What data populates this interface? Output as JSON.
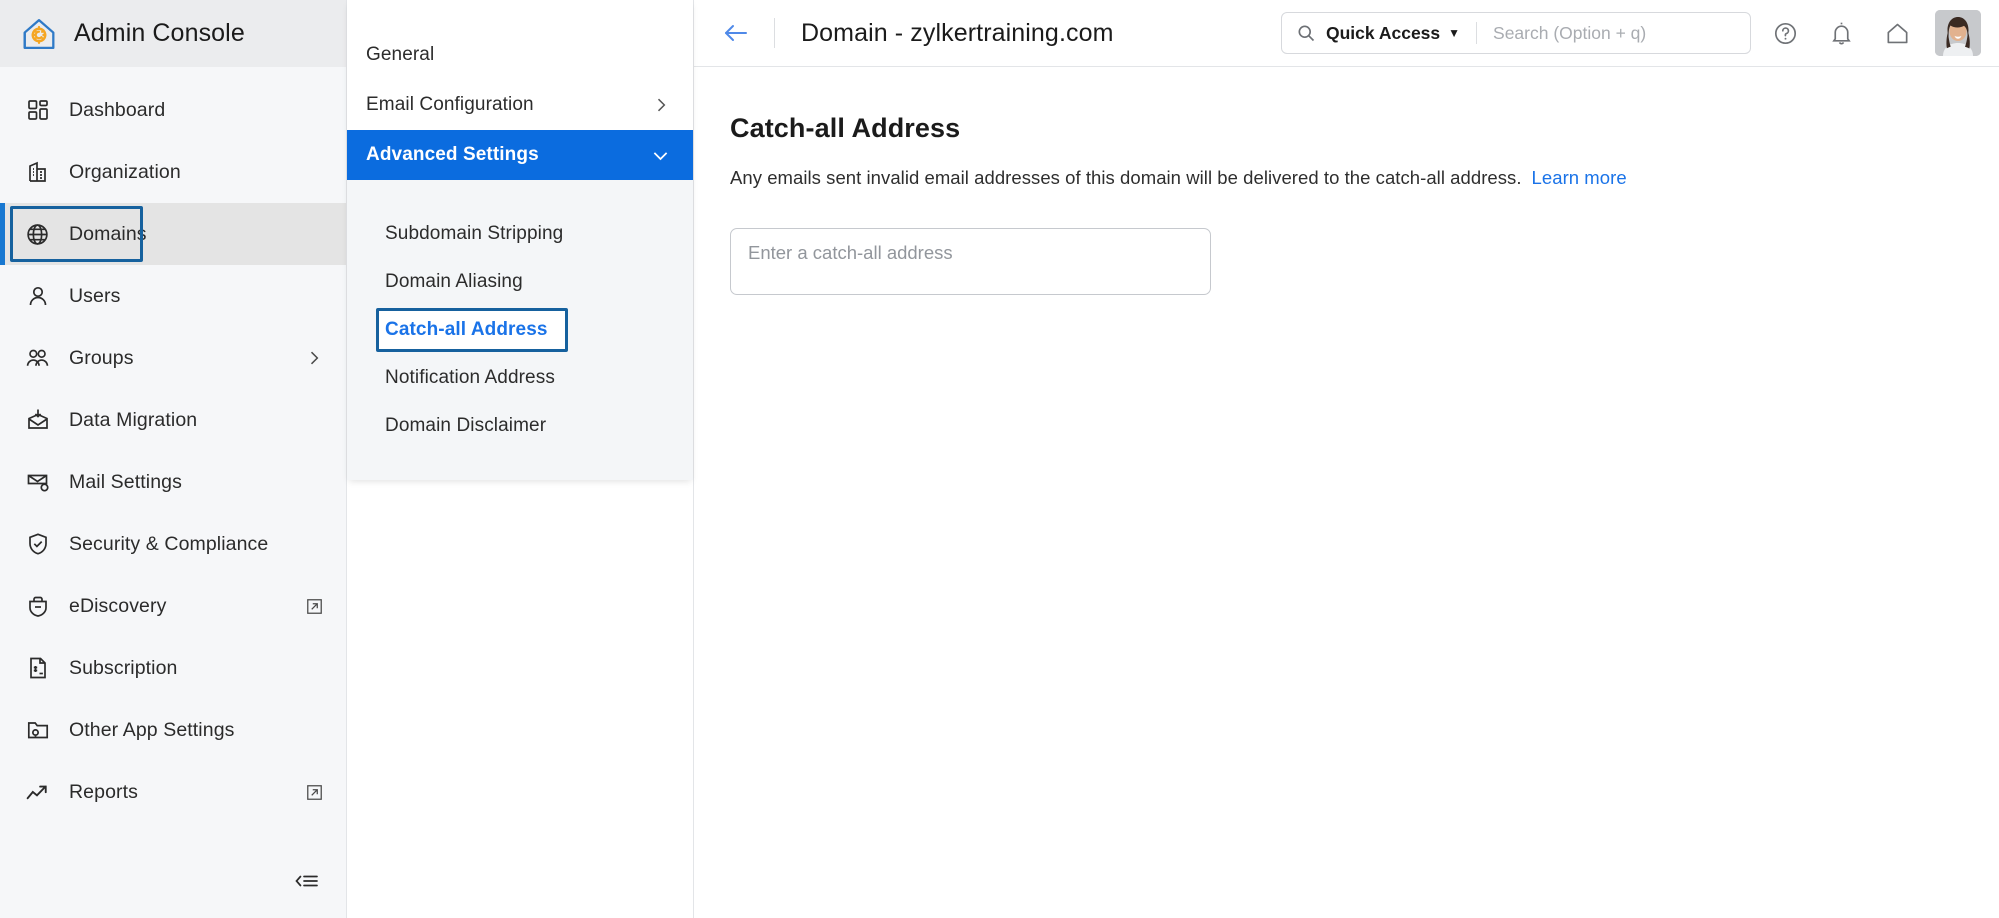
{
  "brand": {
    "title": "Admin Console",
    "logo_icon": "home-gear-logo-icon",
    "logo_colors": {
      "outline": "#2f7ac7",
      "gear": "#f5a623"
    }
  },
  "sidebar": {
    "items": [
      {
        "label": "Dashboard",
        "icon": "dashboard-grid-icon",
        "active": false,
        "external": false,
        "chevron": false
      },
      {
        "label": "Organization",
        "icon": "building-icon",
        "active": false,
        "external": false,
        "chevron": false
      },
      {
        "label": "Domains",
        "icon": "globe-icon",
        "active": true,
        "external": false,
        "chevron": false
      },
      {
        "label": "Users",
        "icon": "user-icon",
        "active": false,
        "external": false,
        "chevron": false
      },
      {
        "label": "Groups",
        "icon": "users-group-icon",
        "active": false,
        "external": false,
        "chevron": true
      },
      {
        "label": "Data Migration",
        "icon": "mail-download-icon",
        "active": false,
        "external": false,
        "chevron": false
      },
      {
        "label": "Mail Settings",
        "icon": "mail-gear-icon",
        "active": false,
        "external": false,
        "chevron": false
      },
      {
        "label": "Security & Compliance",
        "icon": "shield-check-icon",
        "active": false,
        "external": false,
        "chevron": false
      },
      {
        "label": "eDiscovery",
        "icon": "briefcase-icon",
        "active": false,
        "external": true,
        "chevron": false
      },
      {
        "label": "Subscription",
        "icon": "invoice-dollar-icon",
        "active": false,
        "external": false,
        "chevron": false
      },
      {
        "label": "Other App Settings",
        "icon": "folder-gear-icon",
        "active": false,
        "external": false,
        "chevron": false
      },
      {
        "label": "Reports",
        "icon": "trend-up-icon",
        "active": false,
        "external": true,
        "chevron": false
      }
    ],
    "collapse_icon": "collapse-sidebar-icon",
    "active_accent_color": "#1878d1",
    "active_bg_color": "#e4e4e4"
  },
  "submenu": {
    "items": [
      {
        "label": "General",
        "selected": false,
        "chevron": "none"
      },
      {
        "label": "Email Configuration",
        "selected": false,
        "chevron": "right"
      },
      {
        "label": "Advanced Settings",
        "selected": true,
        "chevron": "down"
      }
    ],
    "sub_items": [
      {
        "label": "Subdomain Stripping",
        "current": false
      },
      {
        "label": "Domain Aliasing",
        "current": false
      },
      {
        "label": "Catch-all Address",
        "current": true
      },
      {
        "label": "Notification Address",
        "current": false
      },
      {
        "label": "Domain Disclaimer",
        "current": false
      }
    ],
    "selected_bg_color": "#0b6cdf",
    "current_text_color": "#1a73e8",
    "focus_ring_color": "#16619e"
  },
  "topbar": {
    "back_icon": "back-arrow-icon",
    "title": "Domain - zylkertraining.com",
    "quick_access_label": "Quick Access",
    "quick_access_caret": "▼",
    "search_icon": "search-icon",
    "search_value": "",
    "search_placeholder": "Search (Option + q)",
    "help_icon": "help-circle-icon",
    "notifications_icon": "bell-icon",
    "home_icon": "home-icon",
    "avatar": "user-avatar"
  },
  "main": {
    "title": "Catch-all Address",
    "description": "Any emails sent invalid email addresses of this domain will be delivered to the catch-all address.",
    "learn_more": "Learn more",
    "input_value": "",
    "input_placeholder": "Enter a catch-all address"
  }
}
